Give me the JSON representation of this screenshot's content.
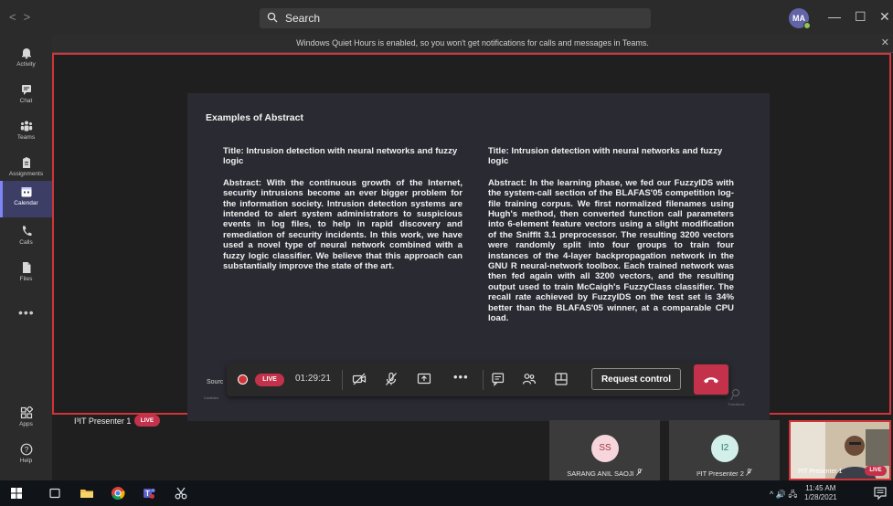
{
  "colors": {
    "accent": "#6264a7",
    "live": "#c4314b",
    "frame": "#d13438"
  },
  "titlebar": {
    "nav_back": "<",
    "nav_forward": ">",
    "search_placeholder": "Search",
    "avatar_initials": "MA",
    "minimize": "—",
    "maximize": "☐",
    "close": "✕"
  },
  "rail": {
    "items": [
      {
        "label": "Activity",
        "icon": "bell-icon"
      },
      {
        "label": "Chat",
        "icon": "chat-icon"
      },
      {
        "label": "Teams",
        "icon": "teams-icon"
      },
      {
        "label": "Assignments",
        "icon": "assignments-icon"
      },
      {
        "label": "Calendar",
        "icon": "calendar-icon",
        "active": true
      },
      {
        "label": "Calls",
        "icon": "phone-icon"
      },
      {
        "label": "Files",
        "icon": "file-icon"
      }
    ],
    "more": "•••",
    "apps": "Apps",
    "help": "Help"
  },
  "notice": {
    "text": "Windows Quiet Hours is enabled, so you won't get notifications for calls and messages in Teams.",
    "close": "✕"
  },
  "slide": {
    "heading": "Examples of Abstract",
    "left_title": "Title: Intrusion detection with neural networks and fuzzy logic",
    "left_abstract": "Abstract: With the continuous growth of the Internet, security intrusions become an ever bigger problem for the information society. Intrusion detection systems are intended to alert system administrators to suspicious events in log files, to help in rapid discovery and remediation of security incidents. In this work, we have used a novel type of neural network combined with a fuzzy logic classifier. We believe that this approach can substantially improve the state of the art.",
    "right_title": "Title: Intrusion detection with neural networks and fuzzy logic",
    "right_abstract": "Abstract: In the learning phase, we fed our FuzzyIDS with the system-call section of the BLAFAS'05 competition log-file training corpus. We first normalized filenames using Hugh's method, then converted function call parameters into 6-element feature vectors using a slight modification of the Snifflt 3.1 preprocessor. The resulting 3200 vectors were randomly split into four groups to train four instances of the 4-layer backpropagation network in the GNU R neural-network toolbox. Each trained network was then fed again with all 3200 vectors, and the resulting output used to train McCaigh's FuzzyClass classifier. The recall rate achieved by FuzzyIDS on the test set is 34% better than the BLAFAS'05 winner, at a comparable CPU load.",
    "source_prefix": "Sourc",
    "confidential_prefix": "Confiden",
    "watermark": "Threatlock"
  },
  "controls": {
    "live": "LIVE",
    "timer": "01:29:21",
    "more": "•••",
    "request_control": "Request control"
  },
  "presenter": {
    "name": "I³IT Presenter 1",
    "live": "LIVE"
  },
  "gallery": [
    {
      "initials": "SS",
      "name": "SARANG ANIL SAOJI",
      "avatar_bg": "#f6d5dc",
      "avatar_fg": "#a4373a"
    },
    {
      "initials": "I2",
      "name": "I²IT Presenter 2",
      "avatar_bg": "#d2efe9",
      "avatar_fg": "#2b7a6b"
    }
  ],
  "camera": {
    "name": "I³IT Presenter 1",
    "live": "LIVE"
  },
  "taskbar": {
    "tray_icons": "^  🔊 🖧",
    "time": "11:45 AM",
    "date": "1/28/2021"
  }
}
